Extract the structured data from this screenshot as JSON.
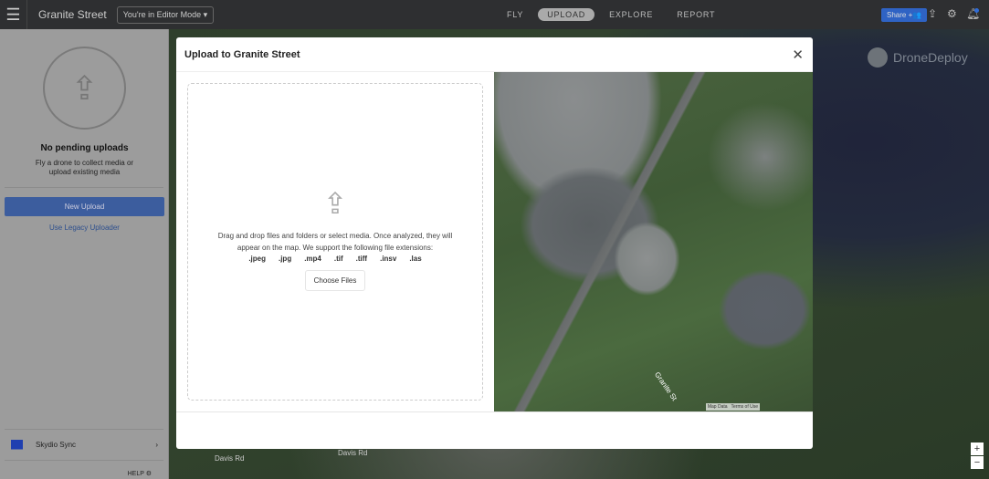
{
  "topbar": {
    "project": "Granite Street",
    "mode": "You're in Editor Mode",
    "nav": [
      "FLY",
      "UPLOAD",
      "EXPLORE",
      "REPORT"
    ],
    "active_nav": "UPLOAD",
    "share": "Share"
  },
  "map": {
    "watermark": "DroneDeploy",
    "roads": [
      "Davis Rd",
      "Davis Rd"
    ]
  },
  "sidebar": {
    "title": "No pending uploads",
    "subtitle": "Fly a drone to collect media or upload existing media",
    "new_upload": "New Upload",
    "legacy": "Use Legacy Uploader",
    "skydio": "Skydio Sync",
    "help": "HELP"
  },
  "modal": {
    "title": "Upload to Granite Street",
    "instructions": "Drag and drop files and folders or select media. Once analyzed, they will appear on the map. We support the following file extensions:",
    "extensions": [
      ".jpeg",
      ".jpg",
      ".mp4",
      ".tif",
      ".tiff",
      ".insv",
      ".las"
    ],
    "choose": "Choose Files",
    "street_label": "Granite St",
    "map_data": "Map Data",
    "terms": "Terms of Use"
  },
  "colors": {
    "accent": "#2f63c4",
    "topbar": "#2e2f31"
  }
}
